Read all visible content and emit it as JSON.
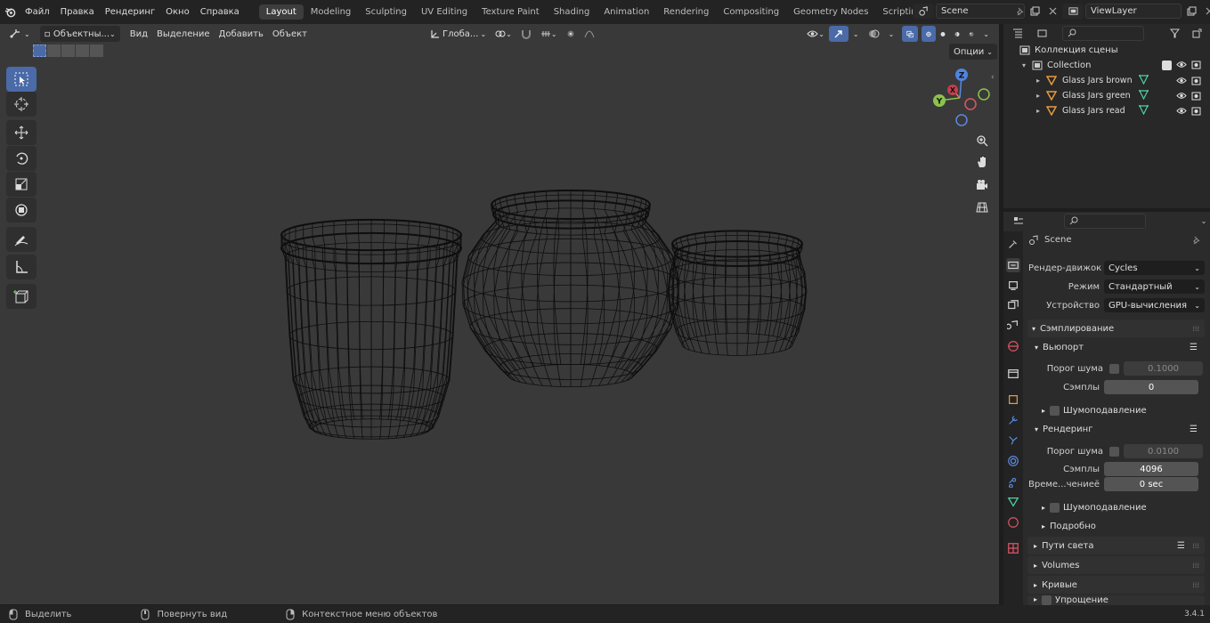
{
  "topbar": {
    "menus": [
      "Файл",
      "Правка",
      "Рендеринг",
      "Окно",
      "Справка"
    ],
    "workspaces": [
      "Layout",
      "Modeling",
      "Sculpting",
      "UV Editing",
      "Texture Paint",
      "Shading",
      "Animation",
      "Rendering",
      "Compositing",
      "Geometry Nodes",
      "Scripting"
    ],
    "active_workspace": "Layout",
    "add_tab": "+",
    "scene_name": "Scene",
    "view_layer": "ViewLayer"
  },
  "viewport": {
    "mode": "Объектны...",
    "menus": [
      "Вид",
      "Выделение",
      "Добавить",
      "Объект"
    ],
    "orientation": "Глоба...",
    "options": "Опции",
    "gizmo": {
      "z": "Z",
      "y": "Y",
      "x": "X"
    }
  },
  "outliner": {
    "scene_collection": "Коллекция сцены",
    "collection": "Collection",
    "items": [
      "Glass Jars brown",
      "Glass Jars green",
      "Glass Jars read"
    ]
  },
  "properties": {
    "context": "Scene",
    "render_engine_label": "Рендер-движок",
    "render_engine": "Cycles",
    "mode_label": "Режим",
    "mode": "Стандартный",
    "device_label": "Устройство",
    "device": "GPU-вычисления",
    "sampling": "Сэмплирование",
    "viewport_sub": "Вьюпорт",
    "noise_threshold_label": "Порог шума",
    "viewport_noise": "0.1000",
    "samples_label": "Сэмплы",
    "viewport_samples": "0",
    "denoise_label": "Шумоподавление",
    "render_sub": "Рендеринг",
    "render_noise": "0.0100",
    "render_samples": "4096",
    "time_limit_label": "Време...чениеё",
    "time_limit": "0 sec",
    "advanced": "Подробно",
    "light_paths": "Пути света",
    "volumes": "Volumes",
    "curves": "Кривые",
    "simplify": "Упрощение"
  },
  "statusbar": {
    "select": "Выделить",
    "rotate": "Повернуть вид",
    "context_menu": "Контекстное меню объектов",
    "version": "3.4.1"
  },
  "colors": {
    "accent": "#4a6aa8",
    "viewport_bg": "#393939",
    "wire": "#0e0e0e"
  }
}
